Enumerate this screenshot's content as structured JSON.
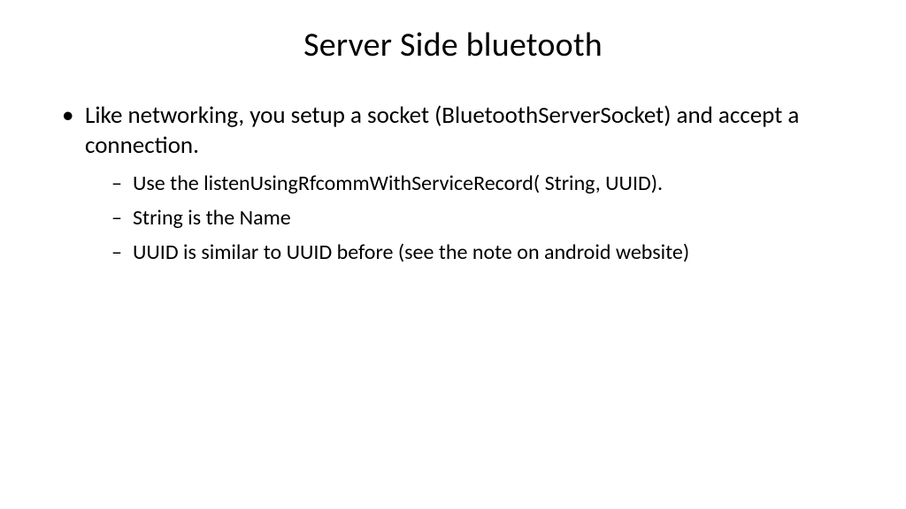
{
  "slide": {
    "title": "Server Side bluetooth",
    "bullets": [
      {
        "text": "Like networking, you setup a socket (BluetoothServerSocket) and accept a connection.",
        "sub": [
          "Use the listenUsingRfcommWithServiceRecord( String, UUID).",
          "String is the Name",
          "UUID is similar to UUID before  (see the note on android website)"
        ]
      }
    ]
  }
}
